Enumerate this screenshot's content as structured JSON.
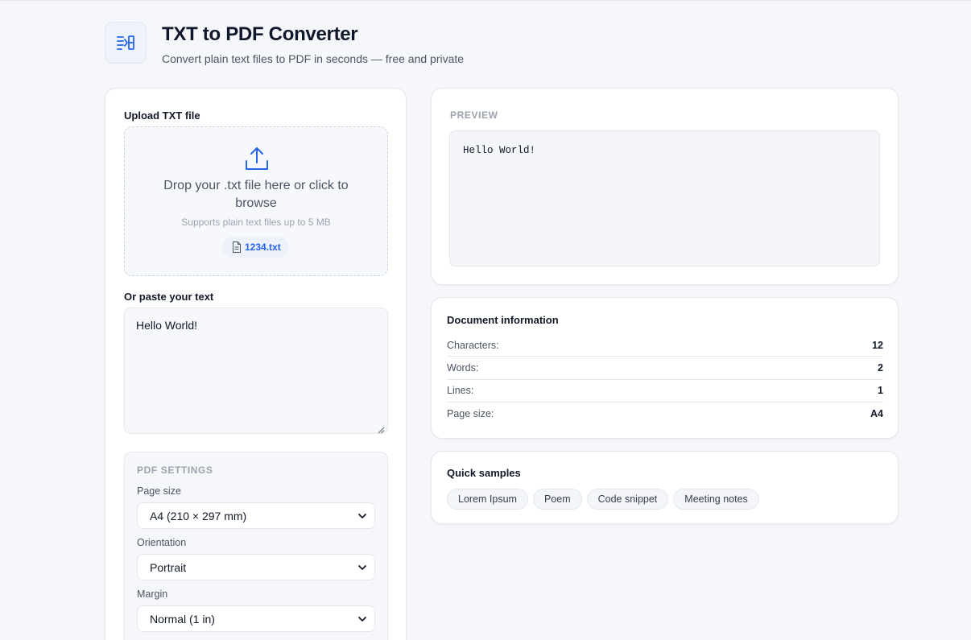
{
  "header": {
    "title": "TXT to PDF Converter",
    "subtitle": "Convert plain text files to PDF in seconds — free and private",
    "logo_icon": "txt-pdf-convert-icon"
  },
  "upload": {
    "label": "Upload TXT file",
    "drop_text": "Drop your .txt file here or click to browse",
    "hint": "Supports plain text files up to 5 MB",
    "file_name": "1234.txt"
  },
  "paste": {
    "label": "Or paste your text",
    "value": "Hello World!"
  },
  "settings": {
    "title": "PDF SETTINGS",
    "page_size_label": "Page size",
    "page_size_value": "A4 (210 × 297 mm)",
    "orientation_label": "Orientation",
    "orientation_value": "Portrait",
    "margin_label": "Margin",
    "margin_value": "Normal (1 in)"
  },
  "preview": {
    "title": "PREVIEW",
    "content": "Hello World!"
  },
  "info": {
    "title": "Document information",
    "rows": [
      {
        "label": "Characters:",
        "value": "12"
      },
      {
        "label": "Words:",
        "value": "2"
      },
      {
        "label": "Lines:",
        "value": "1"
      },
      {
        "label": "Page size:",
        "value": "A4"
      }
    ]
  },
  "samples": {
    "title": "Quick samples",
    "items": [
      "Lorem Ipsum",
      "Poem",
      "Code snippet",
      "Meeting notes"
    ]
  },
  "colors": {
    "accent": "#2563eb",
    "background": "#f5f7fa",
    "card": "#ffffff"
  }
}
